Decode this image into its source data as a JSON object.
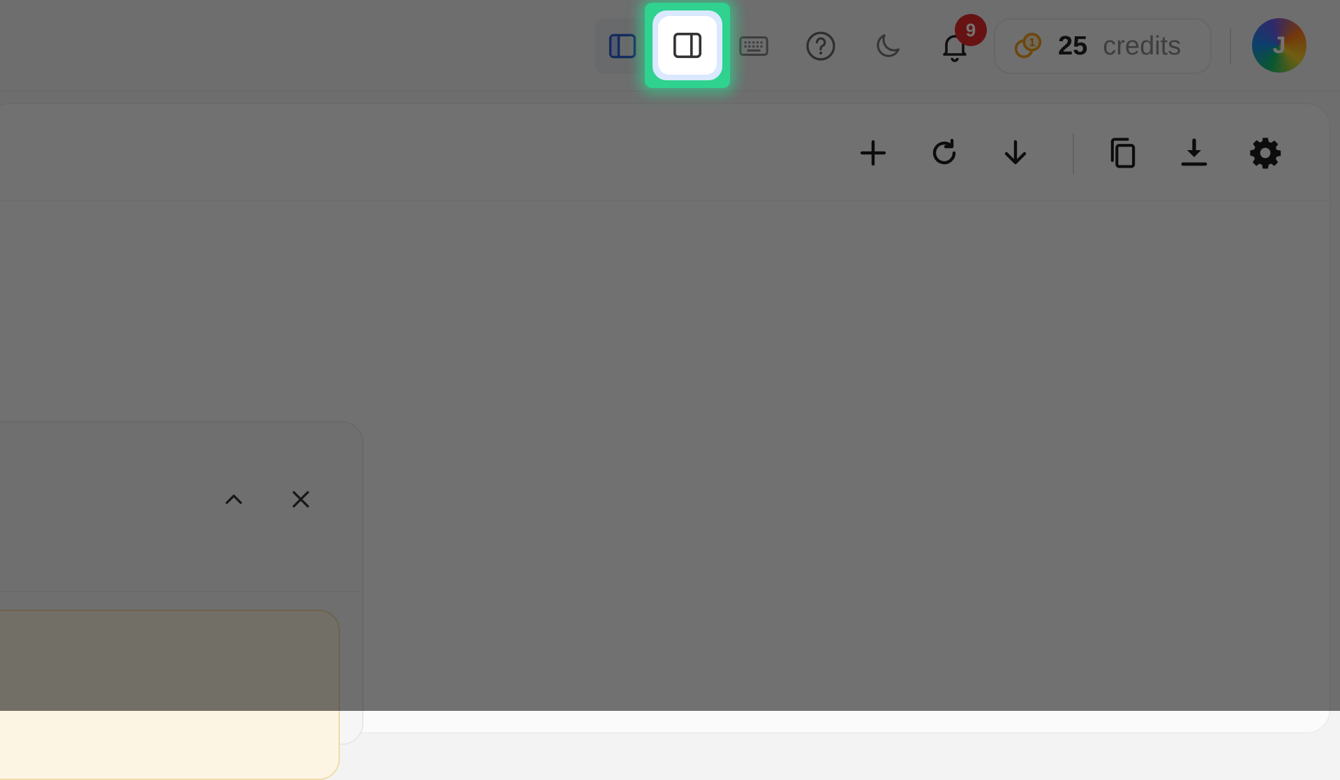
{
  "header": {
    "notification_count": "9",
    "credits": {
      "count": "25",
      "label": "credits"
    },
    "avatar_initial": "J",
    "icons": [
      "sidebar-left-icon",
      "sidebar-right-icon",
      "keyboard-icon",
      "help-icon",
      "moon-icon",
      "bell-icon",
      "coins-icon"
    ]
  },
  "panel_toolbar": {
    "icons": [
      "plus-icon",
      "refresh-icon",
      "arrow-down-icon",
      "copy-icon",
      "download-icon",
      "gear-icon"
    ]
  },
  "card": {
    "icons": [
      "chevron-up-icon",
      "close-icon"
    ]
  },
  "colors": {
    "highlight": "#2fd28f",
    "badge": "#e52b2b",
    "notice_bg": "#fdf5e4",
    "sidebar_left_active": "#2f5fd0"
  }
}
